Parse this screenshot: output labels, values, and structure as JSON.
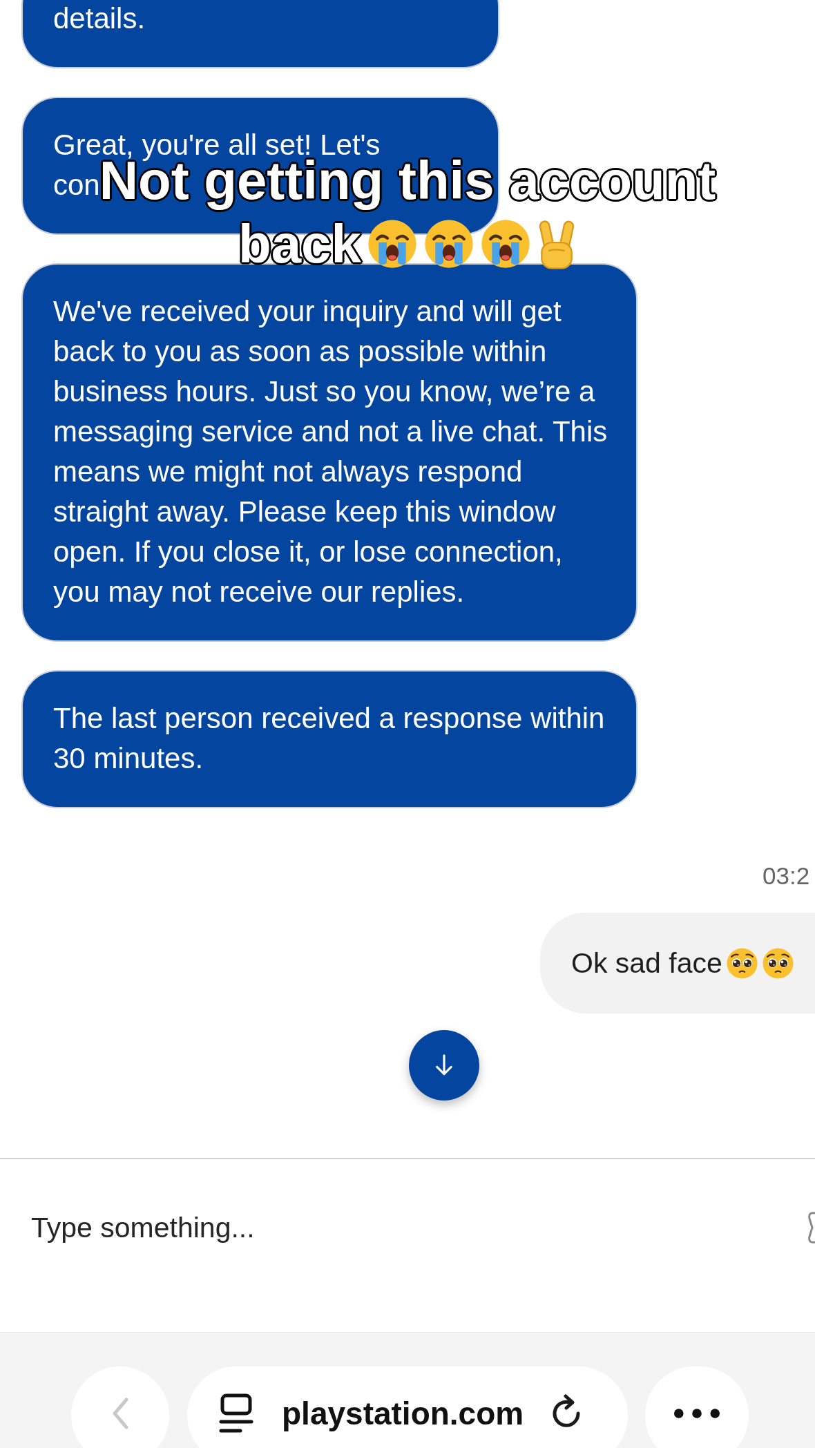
{
  "messages": [
    {
      "kind": "agent",
      "text": "details."
    },
    {
      "kind": "agent",
      "text": "Great, you're all set! Let's\ncon"
    },
    {
      "kind": "agent",
      "text": "We've received your inquiry and will get back to you as soon as possible within business hours. Just so you know, we’re a messaging service and not a live chat. This means we might not always respond straight away. Please keep this window open. If you close it, or lose connection, you may not receive our replies."
    },
    {
      "kind": "agent",
      "text": "The last person received a response within 30 minutes."
    },
    {
      "kind": "timestamp",
      "text": "03:2"
    },
    {
      "kind": "user",
      "text": "Ok sad face",
      "emojis": [
        {
          "kind": "pleading"
        },
        {
          "kind": "pleading"
        }
      ]
    }
  ],
  "composer": {
    "placeholder": "Type something..."
  },
  "browser_bar": {
    "back_disabled": true,
    "url": "playstation.com"
  },
  "caption_overlay": {
    "lines": [
      {
        "text": "Not getting this account"
      },
      {
        "text": "back",
        "emojis": [
          {
            "kind": "crying"
          },
          {
            "kind": "crying"
          },
          {
            "kind": "crying"
          },
          {
            "kind": "peace"
          }
        ]
      }
    ]
  }
}
